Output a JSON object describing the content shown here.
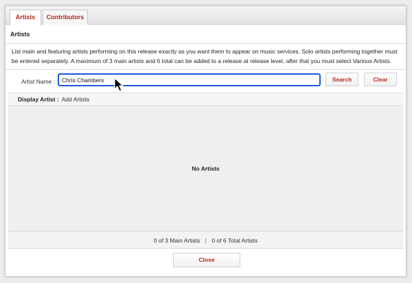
{
  "tabs": [
    {
      "label": "Artists",
      "active": true
    },
    {
      "label": "Contributors",
      "active": false
    }
  ],
  "section_title": "Artists",
  "description": "List main and featuring artists performing on this release exactly as you want them to appear on music services. Solo artists performing together must be entered separately. A maximum of 3 main artists and 6 total can be added to a release at release level, after that you must select Various Artists.",
  "search": {
    "label": "Artist Name :",
    "value": "Chris Chambers",
    "search_button": "Search",
    "clear_button": "Clear"
  },
  "display_artist": {
    "label": "Display Artist :",
    "value": "Add Artists"
  },
  "artists_list": {
    "empty_text": "No Artists"
  },
  "counts": {
    "main": "0 of 3 Main Artists",
    "total": "0 of 6 Total Artists"
  },
  "footer": {
    "close_button": "Close"
  },
  "colors": {
    "accent": "#b5281f",
    "focus": "#1a5ad8"
  }
}
